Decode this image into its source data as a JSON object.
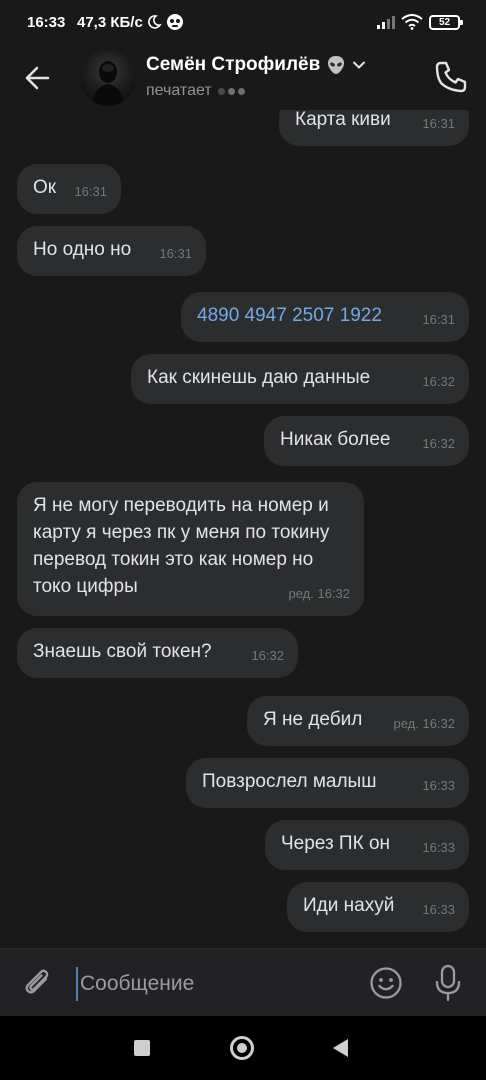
{
  "status_bar": {
    "time": "16:33",
    "speed": "47,3 КБ/с",
    "battery": "52"
  },
  "header": {
    "contact_name": "Семён Строфилёв",
    "status": "печатает"
  },
  "messages": [
    {
      "direction": "out",
      "text": "Карта киви",
      "time": "16:31"
    },
    {
      "direction": "in",
      "text": "Ок",
      "time": "16:31"
    },
    {
      "direction": "in",
      "text": "Но одно но",
      "time": "16:31"
    },
    {
      "direction": "out",
      "text": "4890 4947 2507 1922",
      "time": "16:31",
      "is_link": true
    },
    {
      "direction": "out",
      "text": "Как скинешь даю данные",
      "time": "16:32"
    },
    {
      "direction": "out",
      "text": "Никак более",
      "time": "16:32"
    },
    {
      "direction": "in",
      "text": "Я не могу переводить на номер и карту я через пк  у меня по токину перевод  токин это как номер но токо цифры",
      "time": "ред. 16:32"
    },
    {
      "direction": "in",
      "text": "Знаешь свой токен?",
      "time": "16:32"
    },
    {
      "direction": "out",
      "text": "Я не дебил",
      "time": "ред. 16:32"
    },
    {
      "direction": "out",
      "text": "Повзрослел малыш",
      "time": "16:33"
    },
    {
      "direction": "out",
      "text": "Через ПК он",
      "time": "16:33"
    },
    {
      "direction": "out",
      "text": "Иди нахуй",
      "time": "16:33"
    }
  ],
  "composer": {
    "placeholder": "Сообщение"
  },
  "colors": {
    "background": "#19191a",
    "bubble": "#2c2d2e",
    "link": "#71aaeb",
    "muted": "#76787a"
  }
}
